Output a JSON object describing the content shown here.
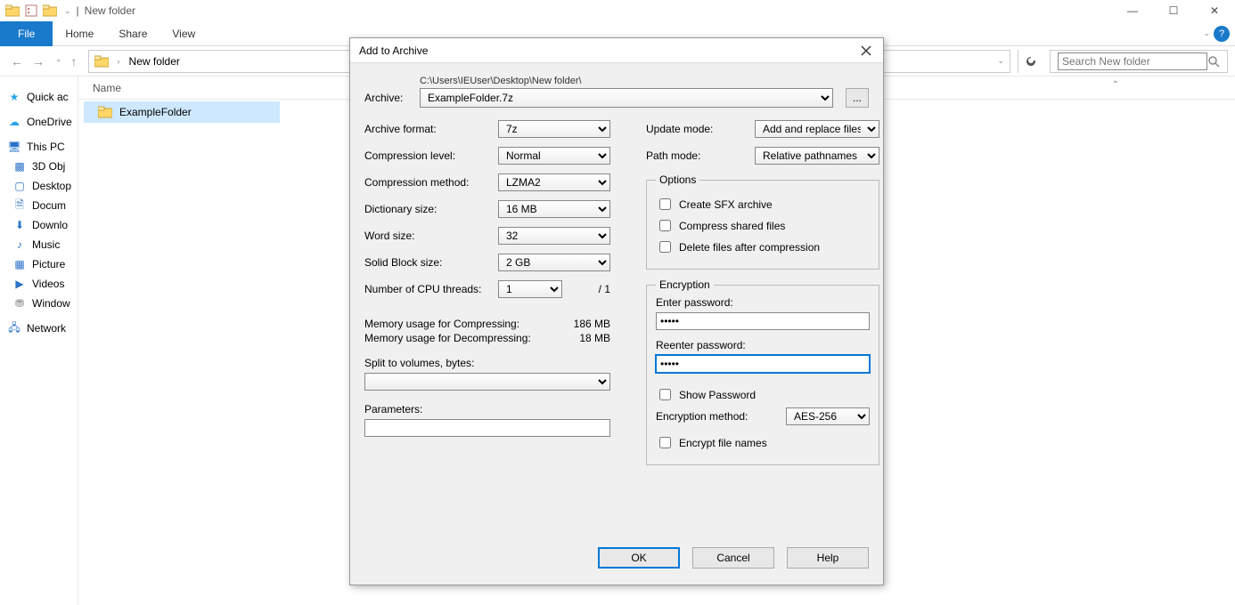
{
  "window": {
    "title": "New folder",
    "controls": {
      "min": "—",
      "max": "☐",
      "close": "✕"
    }
  },
  "ribbon": {
    "file": "File",
    "home": "Home",
    "share": "Share",
    "view": "View"
  },
  "nav": {
    "breadcrumb_item": "New folder",
    "search_placeholder": "Search New folder"
  },
  "sidebar": {
    "quick": "Quick ac",
    "onedrive": "OneDrive",
    "thispc": "This PC",
    "objects3d": "3D Obj",
    "desktop": "Desktop",
    "documents": "Docum",
    "downloads": "Downlo",
    "music": "Music",
    "pictures": "Picture",
    "videos": "Videos",
    "windows": "Window",
    "network": "Network"
  },
  "content": {
    "col_name": "Name",
    "row_folder": "ExampleFolder"
  },
  "dialog": {
    "title": "Add to Archive",
    "archive_label": "Archive:",
    "archive_path": "C:\\Users\\IEUser\\Desktop\\New folder\\",
    "archive_value": "ExampleFolder.7z",
    "browse": "...",
    "left": {
      "format_label": "Archive format:",
      "format_value": "7z",
      "level_label": "Compression level:",
      "level_value": "Normal",
      "method_label": "Compression method:",
      "method_value": "LZMA2",
      "dict_label": "Dictionary size:",
      "dict_value": "16 MB",
      "word_label": "Word size:",
      "word_value": "32",
      "block_label": "Solid Block size:",
      "block_value": "2 GB",
      "cpu_label": "Number of CPU threads:",
      "cpu_value": "1",
      "cpu_max": "/ 1",
      "mem_c_label": "Memory usage for Compressing:",
      "mem_c_value": "186 MB",
      "mem_d_label": "Memory usage for Decompressing:",
      "mem_d_value": "18 MB",
      "split_label": "Split to volumes, bytes:",
      "params_label": "Parameters:"
    },
    "right": {
      "update_label": "Update mode:",
      "update_value": "Add and replace files",
      "path_label": "Path mode:",
      "path_value": "Relative pathnames",
      "options_legend": "Options",
      "opt_sfx": "Create SFX archive",
      "opt_shared": "Compress shared files",
      "opt_delete": "Delete files after compression",
      "enc_legend": "Encryption",
      "enter_pw": "Enter password:",
      "reenter_pw": "Reenter password:",
      "pw_value": "•••••",
      "show_pw": "Show Password",
      "enc_method_label": "Encryption method:",
      "enc_method_value": "AES-256",
      "enc_names": "Encrypt file names"
    },
    "buttons": {
      "ok": "OK",
      "cancel": "Cancel",
      "help": "Help"
    }
  }
}
